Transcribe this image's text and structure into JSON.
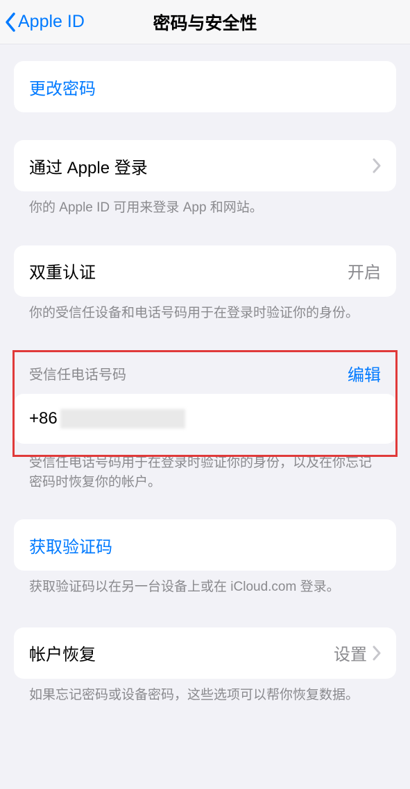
{
  "nav": {
    "back_label": "Apple ID",
    "title": "密码与安全性"
  },
  "change_password": {
    "label": "更改密码"
  },
  "sign_in_with_apple": {
    "label": "通过 Apple 登录",
    "footer": "你的 Apple ID 可用来登录 App 和网站。"
  },
  "two_factor": {
    "label": "双重认证",
    "status": "开启",
    "footer": "你的受信任设备和电话号码用于在登录时验证你的身份。"
  },
  "trusted_phone": {
    "header": "受信任电话号码",
    "edit_label": "编辑",
    "prefix": "+86",
    "footer": "受信任电话号码用于在登录时验证你的身份，以及在你忘记密码时恢复你的帐户。"
  },
  "get_code": {
    "label": "获取验证码",
    "footer": "获取验证码以在另一台设备上或在 iCloud.com 登录。"
  },
  "account_recovery": {
    "label": "帐户恢复",
    "detail": "设置",
    "footer": "如果忘记密码或设备密码，这些选项可以帮你恢复数据。"
  }
}
